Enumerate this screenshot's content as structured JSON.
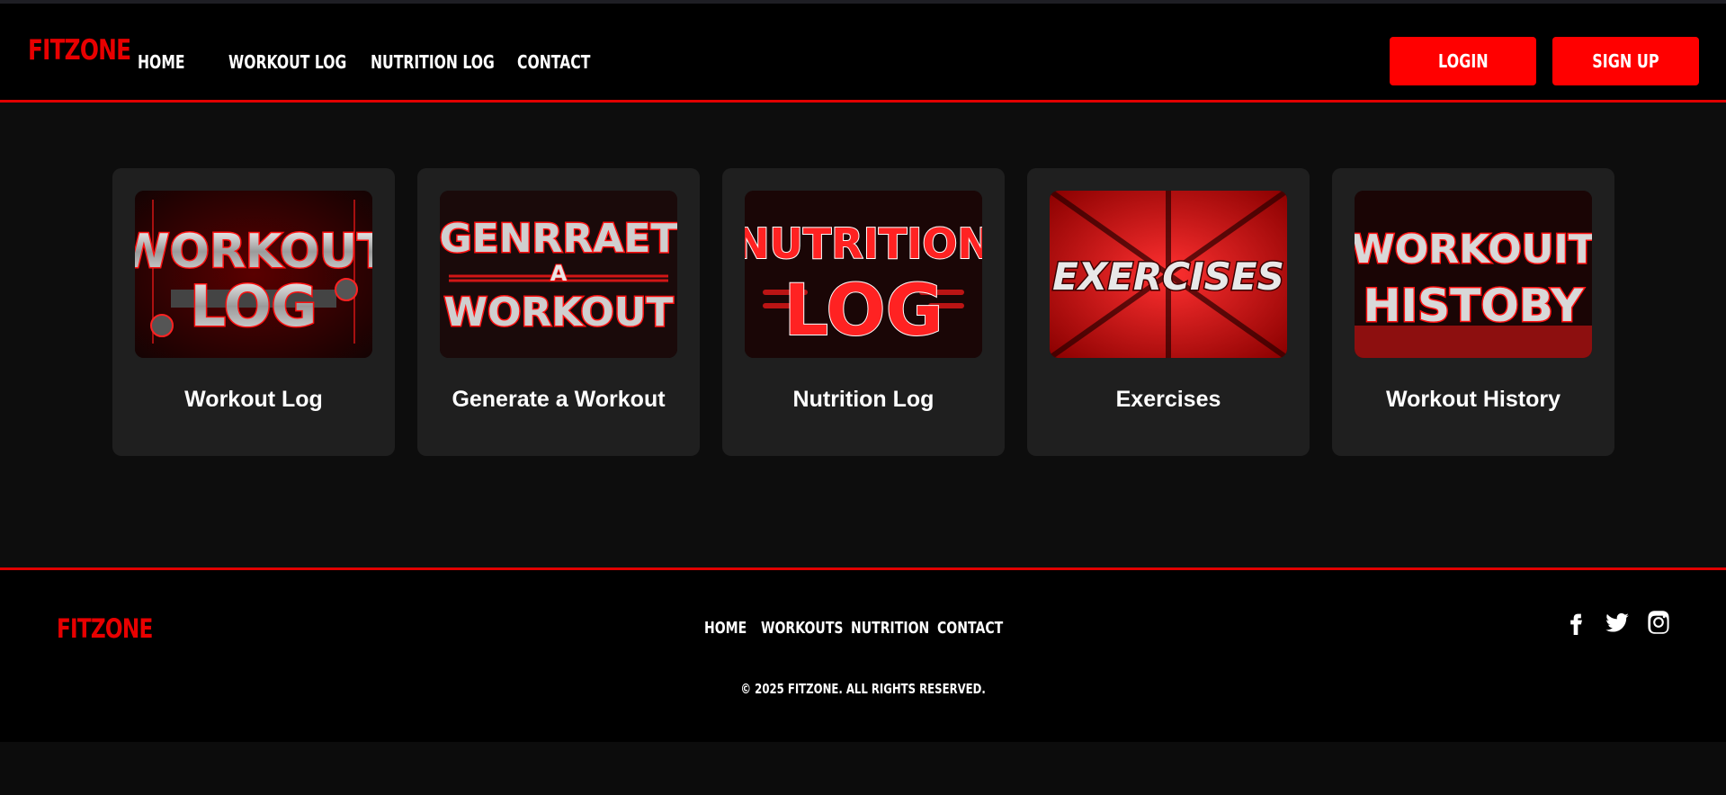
{
  "header": {
    "logo": "FITZONE",
    "nav": [
      "HOME",
      "WORKOUT LOG",
      "NUTRITION LOG",
      "CONTACT"
    ],
    "login_label": "LOGIN",
    "signup_label": "SIGN UP"
  },
  "colors": {
    "accent": "#ff0000",
    "background": "#0d0d0d",
    "card": "#1f1f1f",
    "header": "#000000"
  },
  "cards": [
    {
      "title": "Workout Log",
      "image_text": [
        "WORKOUT",
        "LOG"
      ]
    },
    {
      "title": "Generate a Workout",
      "image_text": [
        "GENRRAET",
        "A",
        "WORKOUT"
      ]
    },
    {
      "title": "Nutrition Log",
      "image_text": [
        "NUTRITION",
        "LOG"
      ]
    },
    {
      "title": "Exercises",
      "image_text": [
        "EXERCISES"
      ]
    },
    {
      "title": "Workout History",
      "image_text": [
        "WORKOUIT",
        "HISTOBY"
      ]
    }
  ],
  "footer": {
    "logo": "FITZONE",
    "nav": [
      "HOME",
      "WORKOUTS",
      "NUTRITION",
      "CONTACT"
    ],
    "social_icons": [
      "facebook-icon",
      "twitter-icon",
      "instagram-icon"
    ],
    "copyright": "© 2025 FITZONE. ALL RIGHTS RESERVED."
  }
}
